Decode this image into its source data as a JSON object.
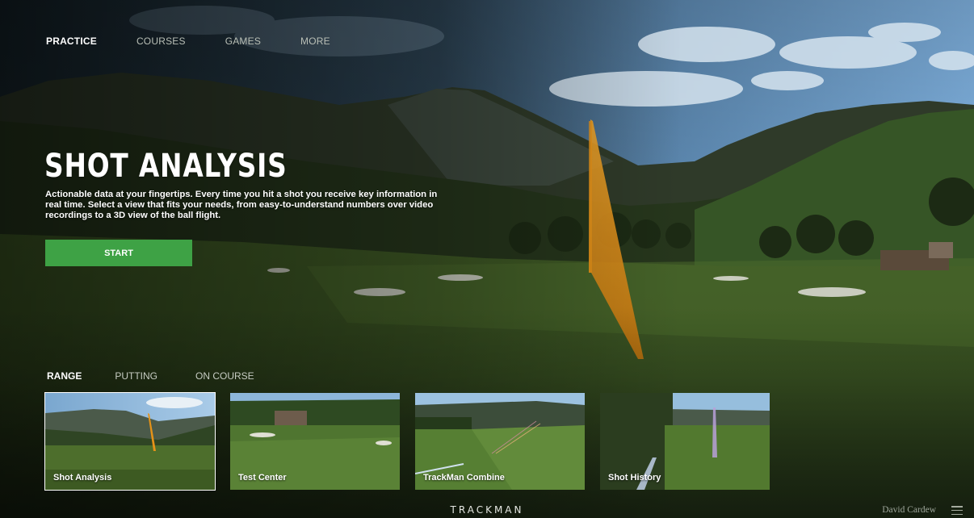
{
  "nav": {
    "items": [
      {
        "label": "PRACTICE",
        "active": true
      },
      {
        "label": "COURSES",
        "active": false
      },
      {
        "label": "GAMES",
        "active": false
      },
      {
        "label": "MORE",
        "active": false
      }
    ]
  },
  "hero": {
    "title": "SHOT ANALYSIS",
    "description": "Actionable data at your fingertips. Every time you hit a shot you receive key information in real time. Select a view that fits your needs, from easy-to-understand numbers over video recordings to a 3D view of the ball flight.",
    "start_label": "START"
  },
  "subtabs": {
    "items": [
      {
        "label": "RANGE",
        "active": true
      },
      {
        "label": "PUTTING",
        "active": false
      },
      {
        "label": "ON COURSE",
        "active": false
      }
    ]
  },
  "cards": {
    "items": [
      {
        "label": "Shot Analysis",
        "selected": true
      },
      {
        "label": "Test Center",
        "selected": false
      },
      {
        "label": "TrackMan Combine",
        "selected": false
      },
      {
        "label": "Shot History",
        "selected": false
      }
    ]
  },
  "footer": {
    "brand": "TRACKMAN",
    "user_name": "David Cardew",
    "menu_icon": "hamburger-menu-icon"
  },
  "colors": {
    "accent_green": "#3ea245",
    "ball_trace": "#e59218"
  }
}
